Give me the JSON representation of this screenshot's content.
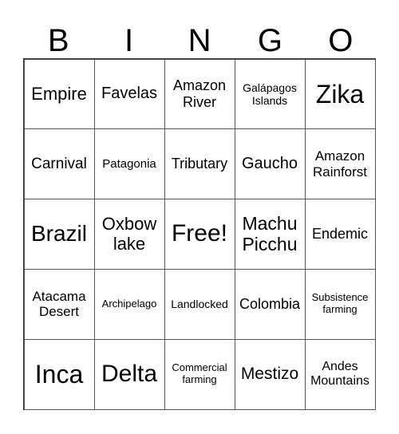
{
  "header": [
    "B",
    "I",
    "N",
    "G",
    "O"
  ],
  "cells": [
    {
      "text": "Empire",
      "size": 22
    },
    {
      "text": "Favelas",
      "size": 20
    },
    {
      "text": "Amazon River",
      "size": 18
    },
    {
      "text": "Galápagos Islands",
      "size": 14
    },
    {
      "text": "Zika",
      "size": 32
    },
    {
      "text": "Carnival",
      "size": 19
    },
    {
      "text": "Patagonia",
      "size": 15
    },
    {
      "text": "Tributary",
      "size": 18
    },
    {
      "text": "Gaucho",
      "size": 20
    },
    {
      "text": "Amazon Rainforst",
      "size": 17
    },
    {
      "text": "Brazil",
      "size": 28
    },
    {
      "text": "Oxbow lake",
      "size": 22
    },
    {
      "text": "Free!",
      "size": 30
    },
    {
      "text": "Machu Picchu",
      "size": 23
    },
    {
      "text": "Endemic",
      "size": 18
    },
    {
      "text": "Atacama Desert",
      "size": 17
    },
    {
      "text": "Archipelago",
      "size": 13
    },
    {
      "text": "Landlocked",
      "size": 14
    },
    {
      "text": "Colombia",
      "size": 18
    },
    {
      "text": "Subsistence farming",
      "size": 13
    },
    {
      "text": "Inca",
      "size": 32
    },
    {
      "text": "Delta",
      "size": 30
    },
    {
      "text": "Commercial farming",
      "size": 13
    },
    {
      "text": "Mestizo",
      "size": 21
    },
    {
      "text": "Andes Mountains",
      "size": 16
    }
  ]
}
